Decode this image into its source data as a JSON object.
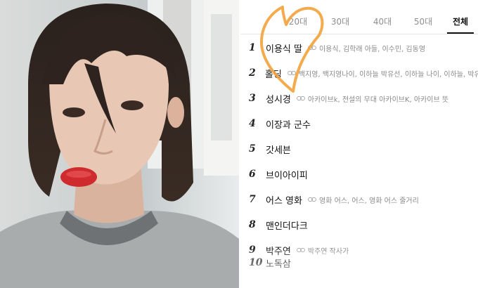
{
  "tabs": [
    {
      "label": "20대",
      "active": false
    },
    {
      "label": "30대",
      "active": false
    },
    {
      "label": "40대",
      "active": false
    },
    {
      "label": "50대",
      "active": false
    },
    {
      "label": "전체",
      "active": true
    }
  ],
  "ranking": [
    {
      "rank": "1",
      "keyword": "이용식 딸",
      "related": "이용식, 김학래 아들, 이수민, 김동영"
    },
    {
      "rank": "2",
      "keyword": "홀딩",
      "related": "백지영, 백지영나이, 이하늘 박유선, 이하늘 나이, 이하늘, 박유..."
    },
    {
      "rank": "3",
      "keyword": "성시경",
      "related": "아카이브k, 전설의 무대 아카이브K, 아카이브 뜻"
    },
    {
      "rank": "4",
      "keyword": "이장과 군수",
      "related": ""
    },
    {
      "rank": "5",
      "keyword": "갓세븐",
      "related": ""
    },
    {
      "rank": "6",
      "keyword": "브이아이피",
      "related": ""
    },
    {
      "rank": "7",
      "keyword": "어스 영화",
      "related": "영화 어스, 어스, 영화 어스 줄거리"
    },
    {
      "rank": "8",
      "keyword": "맨인더다크",
      "related": ""
    },
    {
      "rank": "9",
      "keyword": "박주연",
      "related": "박주연 작사가"
    },
    {
      "rank": "10",
      "keyword": "노독삼",
      "related": ""
    }
  ],
  "colors": {
    "heart": "#f2a23a",
    "active_tab": "#111111",
    "muted": "#8a8a8a"
  },
  "icons": {
    "related": "link-icon",
    "decoration": "heart-doodle"
  }
}
